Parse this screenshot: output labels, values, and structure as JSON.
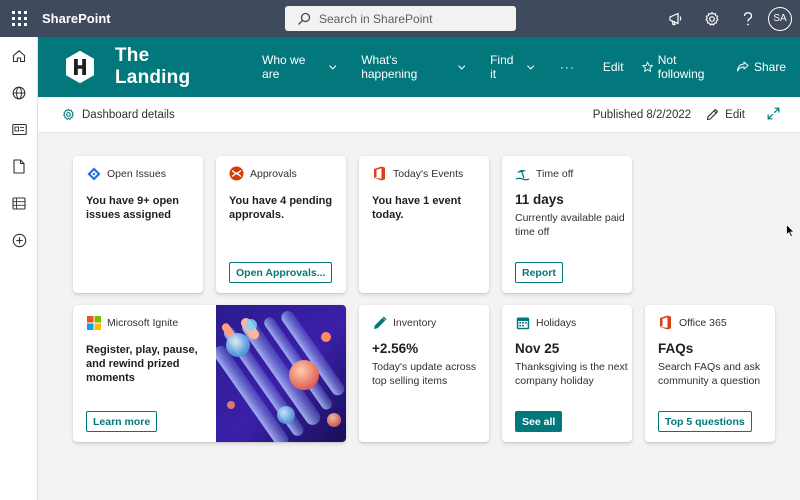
{
  "suite": {
    "app_name": "SharePoint",
    "search_placeholder": "Search in SharePoint",
    "avatar_initials": "SA"
  },
  "site": {
    "logo_letter": "H",
    "title": "The Landing",
    "nav": [
      {
        "label": "Who we are"
      },
      {
        "label": "What's happening"
      },
      {
        "label": "Find it"
      }
    ],
    "more": "···",
    "edit": "Edit",
    "follow": "Not following",
    "share": "Share"
  },
  "command_bar": {
    "dashboard_details": "Dashboard details",
    "published": "Published 8/2/2022",
    "edit": "Edit"
  },
  "cards": {
    "open_issues": {
      "header": "Open Issues",
      "title": "You have 9+ open issues assigned"
    },
    "approvals": {
      "header": "Approvals",
      "title": "You have 4 pending approvals.",
      "button": "Open Approvals..."
    },
    "events": {
      "header": "Today's Events",
      "title": "You have 1 event today."
    },
    "time_off": {
      "header": "Time off",
      "big": "11 days",
      "sub": "Currently available paid time off",
      "button": "Report"
    },
    "ignite": {
      "header": "Microsoft Ignite",
      "title": "Register, play, pause, and rewind prized moments",
      "button": "Learn more"
    },
    "inventory": {
      "header": "Inventory",
      "big": "+2.56%",
      "sub": "Today's update across top selling items"
    },
    "holidays": {
      "header": "Holidays",
      "big": "Nov 25",
      "sub": "Thanksgiving is the next company holiday",
      "button": "See all"
    },
    "office": {
      "header": "Office 365",
      "big": "FAQs",
      "sub": "Search FAQs and ask community a question",
      "button": "Top 5 questions"
    }
  },
  "colors": {
    "suitebar": "#3f4b5c",
    "theme": "#03787c",
    "canvas": "#f3f3f3"
  }
}
